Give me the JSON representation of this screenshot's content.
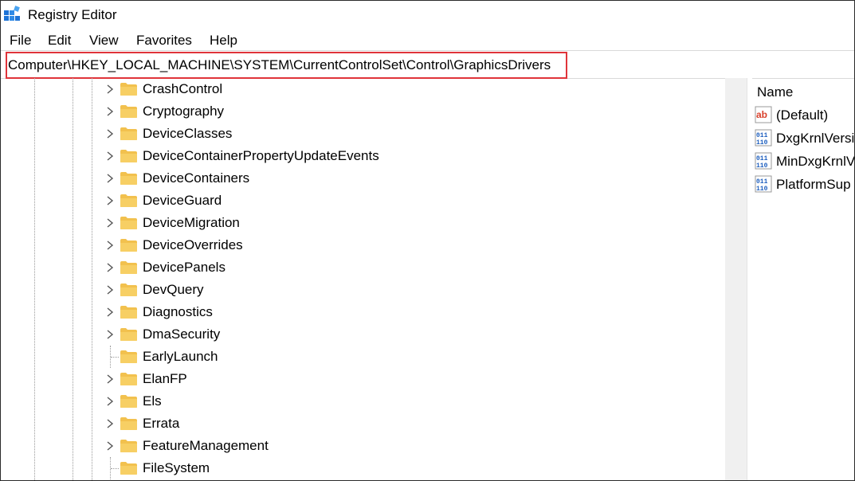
{
  "window": {
    "title": "Registry Editor",
    "app_icon": "registry-editor-icon"
  },
  "menu": [
    "File",
    "Edit",
    "View",
    "Favorites",
    "Help"
  ],
  "address": "Computer\\HKEY_LOCAL_MACHINE\\SYSTEM\\CurrentControlSet\\Control\\GraphicsDrivers",
  "tree": [
    {
      "label": "CrashControl",
      "expandable": true
    },
    {
      "label": "Cryptography",
      "expandable": true
    },
    {
      "label": "DeviceClasses",
      "expandable": true
    },
    {
      "label": "DeviceContainerPropertyUpdateEvents",
      "expandable": true
    },
    {
      "label": "DeviceContainers",
      "expandable": true
    },
    {
      "label": "DeviceGuard",
      "expandable": true
    },
    {
      "label": "DeviceMigration",
      "expandable": true
    },
    {
      "label": "DeviceOverrides",
      "expandable": true
    },
    {
      "label": "DevicePanels",
      "expandable": true
    },
    {
      "label": "DevQuery",
      "expandable": true
    },
    {
      "label": "Diagnostics",
      "expandable": true
    },
    {
      "label": "DmaSecurity",
      "expandable": true
    },
    {
      "label": "EarlyLaunch",
      "expandable": false
    },
    {
      "label": "ElanFP",
      "expandable": true
    },
    {
      "label": "Els",
      "expandable": true
    },
    {
      "label": "Errata",
      "expandable": true
    },
    {
      "label": "FeatureManagement",
      "expandable": true
    },
    {
      "label": "FileSystem",
      "expandable": false
    }
  ],
  "values_pane": {
    "column_name": "Name",
    "items": [
      {
        "name": "(Default)",
        "icon": "string-value-icon"
      },
      {
        "name": "DxgKrnlVersi",
        "icon": "binary-value-icon"
      },
      {
        "name": "MinDxgKrnlV",
        "icon": "binary-value-icon"
      },
      {
        "name": "PlatformSup",
        "icon": "binary-value-icon"
      }
    ]
  },
  "colors": {
    "highlight_border": "#e0343a",
    "folder": "#f2c14e",
    "app_icon": "#1e73d6"
  }
}
